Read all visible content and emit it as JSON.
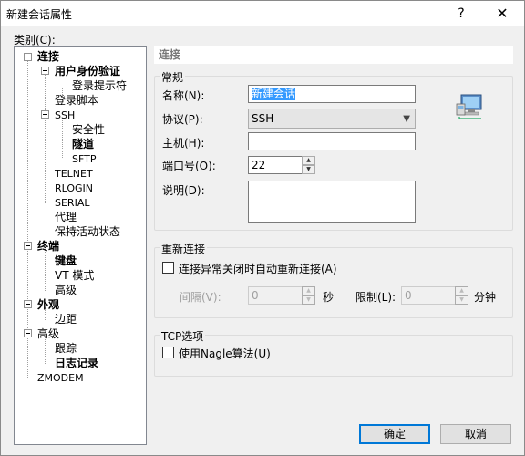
{
  "window": {
    "title": "新建会话属性",
    "help": "?",
    "close": "✕"
  },
  "category_label": "类别(C):",
  "tree": {
    "items": [
      {
        "label": "连接",
        "bold": true
      },
      {
        "label": "用户身份验证",
        "bold": true
      },
      {
        "label": "登录提示符",
        "bold": false
      },
      {
        "label": "登录脚本",
        "bold": false
      },
      {
        "label": "SSH",
        "bold": false
      },
      {
        "label": "安全性",
        "bold": false
      },
      {
        "label": "隧道",
        "bold": true
      },
      {
        "label": "SFTP",
        "bold": false
      },
      {
        "label": "TELNET",
        "bold": false
      },
      {
        "label": "RLOGIN",
        "bold": false
      },
      {
        "label": "SERIAL",
        "bold": false
      },
      {
        "label": "代理",
        "bold": false
      },
      {
        "label": "保持活动状态",
        "bold": false
      },
      {
        "label": "终端",
        "bold": true
      },
      {
        "label": "键盘",
        "bold": true
      },
      {
        "label": "VT 模式",
        "bold": false
      },
      {
        "label": "高级",
        "bold": false
      },
      {
        "label": "外观",
        "bold": true
      },
      {
        "label": "边距",
        "bold": false
      },
      {
        "label": "高级",
        "bold": false
      },
      {
        "label": "跟踪",
        "bold": false
      },
      {
        "label": "日志记录",
        "bold": true
      },
      {
        "label": "ZMODEM",
        "bold": false
      }
    ]
  },
  "panel": {
    "header": "连接",
    "general": {
      "title": "常规",
      "name_label": "名称(N):",
      "name_value": "新建会话",
      "protocol_label": "协议(P):",
      "protocol_value": "SSH",
      "host_label": "主机(H):",
      "host_value": "",
      "port_label": "端口号(O):",
      "port_value": "22",
      "desc_label": "说明(D):",
      "desc_value": ""
    },
    "reconnect": {
      "title": "重新连接",
      "auto_label": "连接异常关闭时自动重新连接(A)",
      "auto_checked": false,
      "interval_label": "间隔(V):",
      "interval_value": "0",
      "interval_unit": "秒",
      "limit_label": "限制(L):",
      "limit_value": "0",
      "limit_unit": "分钟"
    },
    "tcp": {
      "title": "TCP选项",
      "nagle_label": "使用Nagle算法(U)",
      "nagle_checked": false
    }
  },
  "buttons": {
    "ok": "确定",
    "cancel": "取消"
  }
}
